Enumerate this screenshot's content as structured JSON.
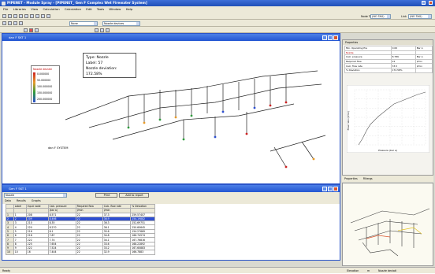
{
  "app": {
    "title": "PIPENET - Module Spray - [PIPENET_ Gen F Complex Wet Firewater System]"
  },
  "menu": [
    "File",
    "Libraries",
    "View",
    "Calculation",
    "Calculation",
    "Edit",
    "Tools",
    "Window",
    "Help"
  ],
  "toolbar": {
    "tag_label": "Node Tag",
    "tag_value": "(NO TAG)",
    "link_label": "Link",
    "link_value": "(NO TAG)",
    "style_value": "None",
    "pick_value": "Nozzle devices"
  },
  "drawing": {
    "title": "dan F SKT 1",
    "tooltip": {
      "type": "Type: Nozzle",
      "label": "Label: 57",
      "deviation": "Nozzle deviation: 172.58%"
    },
    "legend": {
      "title": "Nozzle deviati",
      "ticks": [
        "0.000000",
        "50.000000",
        "100.000000",
        "150.000000",
        "200.000000"
      ]
    },
    "annotation": "dan F SYSTEM"
  },
  "results": {
    "title": "Gen F SKT 1",
    "selector": "Nozzle",
    "print_label": "Print",
    "add_report_label": "Add to report",
    "tabs": [
      "Data",
      "Results",
      "Graphs"
    ],
    "columns": [
      "Label",
      "Input node",
      "Calc. pressure",
      "Required flow",
      "Calc. flow rate",
      "% Deviation"
    ],
    "units": [
      "",
      "",
      "(bar a)",
      "l/min",
      "l/min",
      ""
    ],
    "rows": [
      [
        "1",
        "208",
        "8.571",
        "22",
        "37.3",
        "259.57407"
      ],
      [
        "2",
        "209",
        "8.466",
        "22",
        "36.9",
        "254.19882"
      ],
      [
        "3",
        "210",
        "8.35",
        "22",
        "36.3",
        "252.69751"
      ],
      [
        "4",
        "220",
        "8.270",
        "22",
        "36.1",
        "250.60645"
      ],
      [
        "5",
        "216",
        "8.1",
        "22",
        "35.6",
        "154.27669"
      ],
      [
        "6",
        "218",
        "7.87",
        "22",
        "34.8",
        "166.74574"
      ],
      [
        "7",
        "222",
        "7.74",
        "22",
        "34.1",
        "167.76816"
      ],
      [
        "8",
        "225",
        "7.654",
        "22",
        "33.6",
        "168.22892"
      ],
      [
        "9",
        "222",
        "7.524",
        "22",
        "33.2",
        "167.60883"
      ],
      [
        "10",
        "16",
        "7.444",
        "22",
        "32.9",
        "166.7883"
      ]
    ],
    "selected_row": 1
  },
  "properties": {
    "title": "Properties",
    "rows": [
      [
        "Min. Operating Pre",
        "0.00",
        "Bar A"
      ],
      [
        "Nozzle",
        "",
        ""
      ],
      [
        "Calc. pressure",
        "8.786",
        "Bar A"
      ],
      [
        "Required flow",
        "22",
        "l/min"
      ],
      [
        "Calc. flow rate",
        "33.5",
        "l/min"
      ],
      [
        "% Deviation",
        "172.58%",
        ""
      ]
    ],
    "tabs": [
      "Properties",
      "Filtergs"
    ],
    "chart_data": {
      "type": "line",
      "title": "",
      "xlabel": "Pressure (bar a)",
      "ylabel": "Flow rate (l/min)",
      "x": [
        0.5,
        1,
        1.5,
        2,
        3,
        4,
        5,
        6,
        7,
        8,
        9
      ],
      "y": [
        0,
        4,
        9,
        13,
        18,
        22,
        26,
        28,
        30,
        32,
        33.5
      ],
      "xlim": [
        0,
        9
      ],
      "ylim": [
        0,
        35
      ],
      "grid": true
    }
  },
  "status": {
    "left": "Ready",
    "mid1": "Elevation",
    "mid2": "m",
    "right": "Nozzle deviati"
  }
}
